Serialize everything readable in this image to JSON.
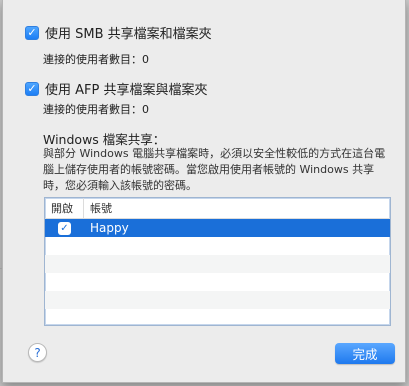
{
  "smb": {
    "checked": true,
    "label": "使用 SMB 共享檔案和檔案夾",
    "connected": "連接的使用者數目：0"
  },
  "afp": {
    "checked": true,
    "label": "使用 AFP 共享檔案與檔案夾",
    "connected": "連接的使用者數目：0"
  },
  "windows": {
    "title": "Windows 檔案共享：",
    "note": "與部分 Windows 電腦共享檔案時，必須以安全性較低的方式在這台電腦上儲存使用者的帳號密碼。當您啟用使用者帳號的 Windows 共享時，您必須輸入該帳號的密碼。"
  },
  "table": {
    "headers": {
      "enable": "開啟",
      "account": "帳號"
    },
    "rows": [
      {
        "enabled": true,
        "account": "Happy"
      }
    ]
  },
  "buttons": {
    "help": "?",
    "done": "完成"
  },
  "icons": {
    "check": "✓"
  },
  "colors": {
    "accent": "#1a6fd9"
  }
}
